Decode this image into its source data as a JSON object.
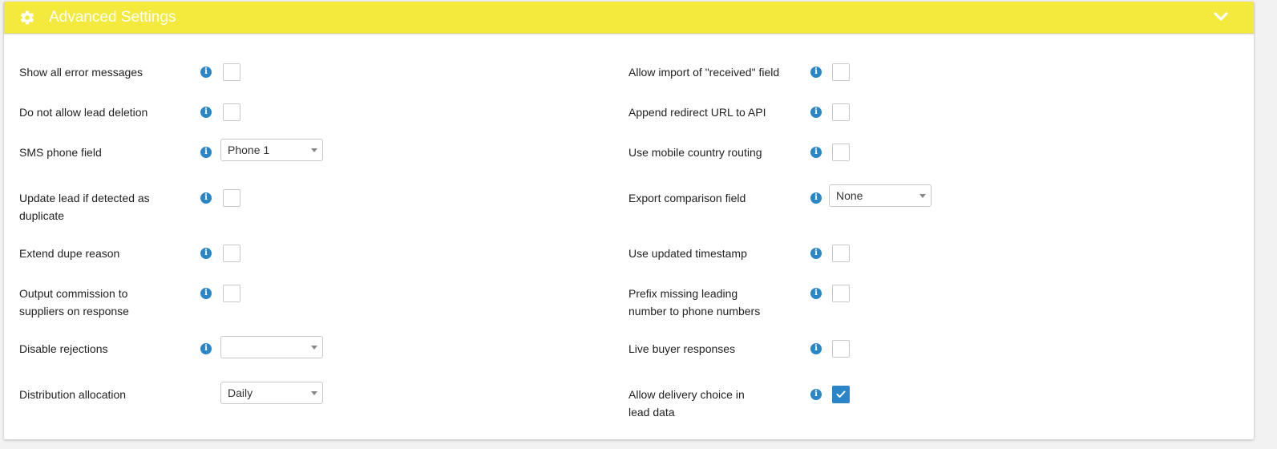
{
  "header": {
    "title": "Advanced Settings",
    "icon": "gear-icon",
    "toggle_icon": "chevron-down-icon",
    "background_color": "#f3ea3d"
  },
  "accent_color": "#2a86c7",
  "left_column": [
    {
      "label": "Show all error messages",
      "control": "checkbox",
      "checked": false
    },
    {
      "label": "Do not allow lead deletion",
      "control": "checkbox",
      "checked": false
    },
    {
      "label": "SMS phone field",
      "control": "select",
      "value": "Phone 1"
    },
    {
      "label": "Update lead if detected as duplicate",
      "control": "checkbox",
      "checked": false
    },
    {
      "label": "Extend dupe reason",
      "control": "checkbox",
      "checked": false
    },
    {
      "label": "Output commission to suppliers on response",
      "control": "checkbox",
      "checked": false
    },
    {
      "label": "Disable rejections",
      "control": "select",
      "value": ""
    },
    {
      "label": "Distribution allocation",
      "control": "select",
      "value": "Daily"
    }
  ],
  "right_column": [
    {
      "label": "Allow import of \"received\" field",
      "control": "checkbox",
      "checked": false
    },
    {
      "label": "Append redirect URL to API",
      "control": "checkbox",
      "checked": false
    },
    {
      "label": "Use mobile country routing",
      "control": "checkbox",
      "checked": false
    },
    {
      "label": "Export comparison field",
      "control": "select",
      "value": "None"
    },
    {
      "label": "Use updated timestamp",
      "control": "checkbox",
      "checked": false
    },
    {
      "label": "Prefix missing leading number to phone numbers",
      "control": "checkbox",
      "checked": false
    },
    {
      "label": "Live buyer responses",
      "control": "checkbox",
      "checked": false
    },
    {
      "label": "Allow delivery choice in lead data",
      "control": "checkbox",
      "checked": true
    }
  ]
}
